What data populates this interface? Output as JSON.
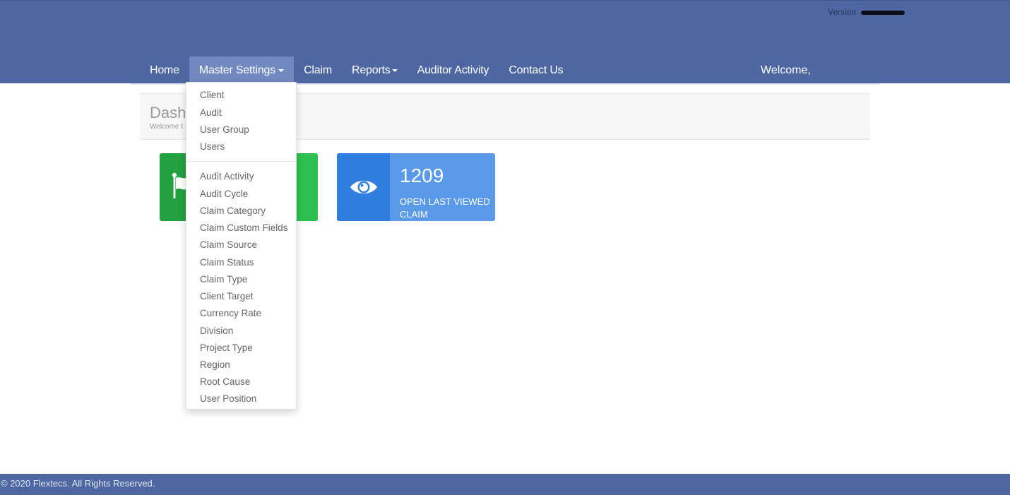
{
  "header": {
    "version_label": "Version:",
    "welcome_text": "Welcome,"
  },
  "nav": {
    "items": [
      {
        "label": "Home"
      },
      {
        "label": "Master Settings"
      },
      {
        "label": "Claim"
      },
      {
        "label": "Reports"
      },
      {
        "label": "Auditor Activity"
      },
      {
        "label": "Contact Us"
      }
    ]
  },
  "dropdown": {
    "group1": [
      "Client",
      "Audit",
      "User Group",
      "Users"
    ],
    "group2": [
      "Audit Activity",
      "Audit Cycle",
      "Claim Category",
      "Claim Custom Fields",
      "Claim Source",
      "Claim Status",
      "Claim Type",
      "Client Target",
      "Currency Rate",
      "Division",
      "Project Type",
      "Region",
      "Root Cause",
      "User Position"
    ]
  },
  "page": {
    "title": "Dash",
    "subtitle": "Welcome t"
  },
  "tiles": {
    "flag": {
      "icon": "flag-icon",
      "color": "#2ec04e"
    },
    "last_viewed": {
      "icon": "eye-icon",
      "number": "1209",
      "label": "OPEN LAST VIEWED CLAIM",
      "color": "#5b9ae8"
    }
  },
  "colors": {
    "header_bg": "#4e67a3",
    "nav_active": "#7289c0"
  },
  "footer": {
    "text": "© 2020 Flextecs. All Rights Reserved."
  }
}
